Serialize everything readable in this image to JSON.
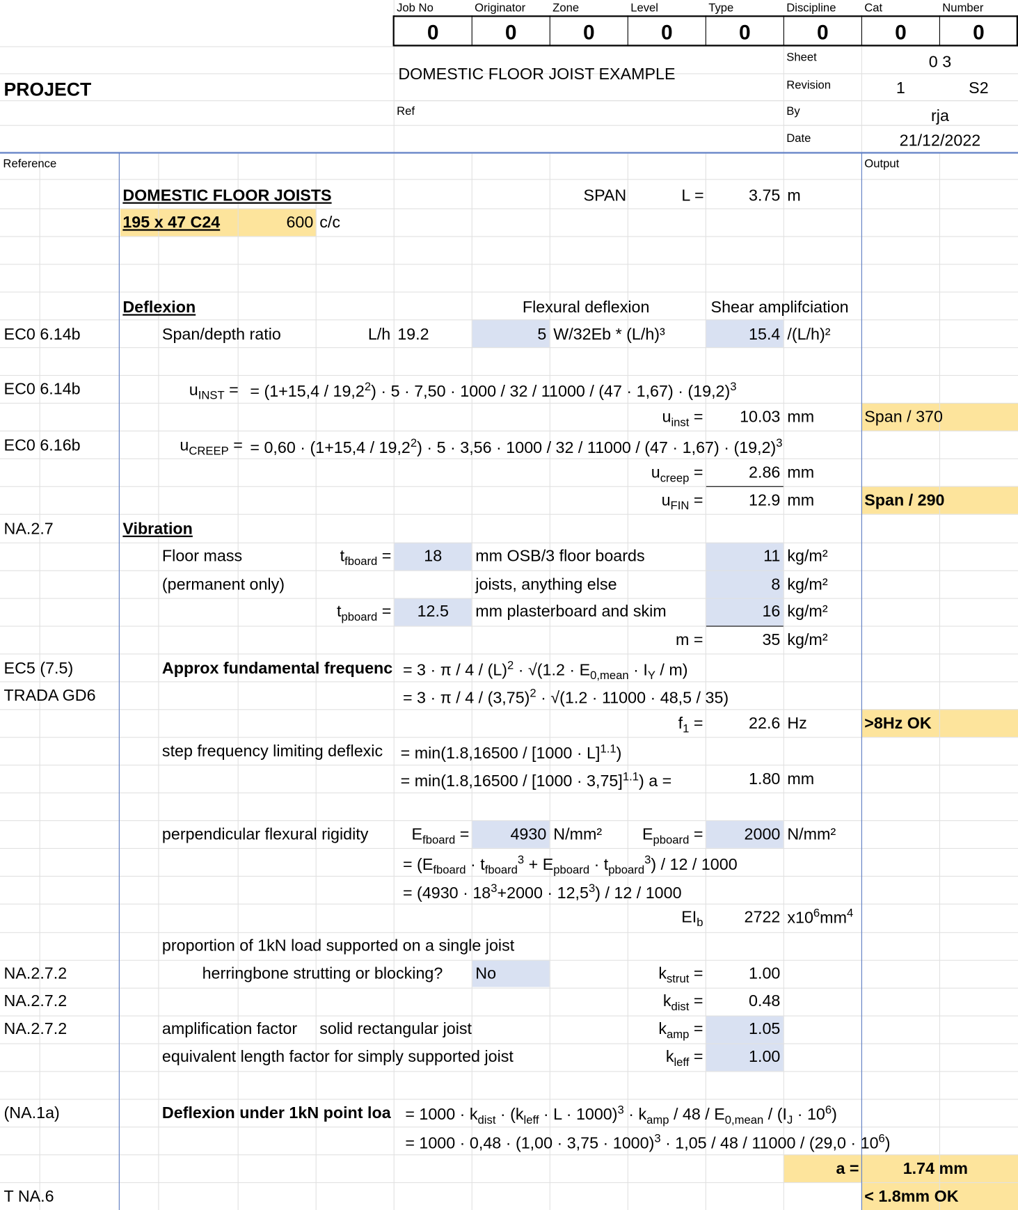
{
  "header": {
    "labels": [
      "Job No",
      "Originator",
      "Zone",
      "Level",
      "Type",
      "Discipline",
      "Cat",
      "Number"
    ],
    "values": [
      "0",
      "0",
      "0",
      "0",
      "0",
      "0",
      "0",
      "0"
    ],
    "project_label": "PROJECT",
    "title": "DOMESTIC FLOOR JOIST EXAMPLE",
    "sheet_label": "Sheet",
    "sheet_value": "0 3",
    "revision_label": "Revision",
    "revision_value": "1",
    "revision_status": "S2",
    "ref_label": "Ref",
    "by_label": "By",
    "by_value": "rja",
    "date_label": "Date",
    "date_value": "21/12/2022",
    "reference_label": "Reference",
    "output_label": "Output"
  },
  "calc": {
    "heading": "DOMESTIC FLOOR JOISTS",
    "section": "195 x 47 C24",
    "spacing": "600",
    "spacing_unit": "c/c",
    "span_label": "SPAN",
    "span_symbol": "L =",
    "span_value": "3.75",
    "span_unit": "m",
    "deflexion_heading": "Deflexion",
    "flexural_deflexion": "Flexural deflexion",
    "shear_amplification": "Shear amplifciation",
    "ref_eco_614b": "EC0 6.14b",
    "ref_eco_616b": "EC0 6.16b",
    "span_depth_label": "Span/depth ratio",
    "lh_label": "L/h",
    "lh_value": "19.2",
    "flex_coeff": "5",
    "flex_formula": "W/32Eb * (L/h)³",
    "shear_coeff": "15.4",
    "shear_formula": "/(L/h)²",
    "uinst_label_main": "u",
    "uinst_label_sub": "INST",
    "uinst_eq_start": "= (1+15,4 / 19,2",
    "uinst_eq_mid": ") · 5 · 7,50 · 1000 / 32 / 11000 / (47 · 1,67) · (19,2)",
    "sup2": "2",
    "sup3": "3",
    "uinst_res_main": "u",
    "uinst_res_sub": "inst",
    "uinst_value": "10.03",
    "mm": "mm",
    "uinst_output": "Span / 370",
    "ucreep_label_main": "u",
    "ucreep_label_sub": "CREEP",
    "ucreep_eq_start": "= 0,60 · (1+15,4 / 19,2",
    "ucreep_eq_mid": ") · 5 · 3,56 · 1000 / 32 / 11000 / (47 · 1,67) · (19,2)",
    "ucreep_res_main": "u",
    "ucreep_res_sub": "creep",
    "ucreep_value": "2.86",
    "ufin_res_main": "u",
    "ufin_res_sub": "FIN",
    "ufin_value": "12.9",
    "ufin_output": "Span / 290",
    "eq": "=",
    "ref_na27": "NA.2.7",
    "vibration_heading": "Vibration",
    "floor_mass_label": "Floor mass",
    "permanent_only": "(permanent only)",
    "t_main": "t",
    "tfboard_sub": "fboard",
    "tfboard_value": "18",
    "osb_label": "mm OSB/3 floor boards",
    "osb_mass": "11",
    "kgm2": "kg/m²",
    "joists_label": "joists, anything else",
    "joists_mass": "8",
    "tpboard_sub": "pboard",
    "tpboard_value": "12.5",
    "plaster_label": "mm plasterboard and skim",
    "plaster_mass": "16",
    "m_label": "m =",
    "m_value": "35",
    "ref_ec5": "EC5 (7.5)",
    "ref_trada": "TRADA GD6",
    "approx_freq_label": "Approx fundamental frequenc",
    "freq_eq1_a": "= 3 · π / 4 / (L)",
    "freq_eq1_b": " · √(1.2 · E",
    "freq_eq1_sub": "0,mean",
    "freq_eq1_c": " · I",
    "freq_eq1_sub2": "Y",
    "freq_eq1_d": " / m)",
    "freq_eq2_a": "= 3 · π / 4 / (3,75)",
    "freq_eq2_b": " · √(1.2 · 11000 · 48,5 / 35)",
    "f1_main": "f",
    "f1_sub": "1",
    "f1_value": "22.6",
    "hz": "Hz",
    "f1_output": ">8Hz OK",
    "step_label": "step frequency limiting deflexic",
    "step_eq1_a": "= min(1.8,16500 / [1000 · L]",
    "step_eq1_sup": "1.1",
    "step_eq1_b": ")",
    "step_eq2_a": "= min(1.8,16500 / [1000 · 3,75]",
    "step_eq2_b": ")   a =",
    "a_value": "1.80",
    "perp_label": "perpendicular flexural rigidity",
    "e_main": "E",
    "efboard_sub": "fboard",
    "efboard_value": "4930",
    "nmm2": "N/mm²",
    "epboard_sub": "pboard",
    "epboard_value": "2000",
    "rig_eq1_a": "= (E",
    "rig_eq1_b": " · t",
    "rig_eq1_c": " + E",
    "rig_eq1_d": ") / 12 / 1000",
    "rig_eq2_a": "= (4930 · 18",
    "rig_eq2_b": "+2000 · 12,5",
    "rig_eq2_c": ") / 12 / 1000",
    "eib_main": "EI",
    "eib_sub": "b",
    "eib_value": "2722",
    "eib_unit_a": "x10",
    "eib_unit_sup": "6",
    "eib_unit_b": "mm",
    "eib_unit_sup2": "4",
    "proportion_label": "proportion of 1kN load supported on a single joist",
    "ref_na272": "NA.2.7.2",
    "herringbone_label": "herringbone strutting or blocking?",
    "herringbone_value": "No",
    "k_main": "k",
    "kstrut_sub": "strut",
    "kstrut_value": "1.00",
    "kdist_sub": "dist",
    "kdist_value": "0.48",
    "amp_label": "amplification factor",
    "solid_label": "solid rectangular joist",
    "kamp_sub": "amp",
    "kamp_value": "1.05",
    "equiv_label": "equivalent length factor for simply supported joist",
    "kleff_sub": "leff",
    "kleff_value": "1.00",
    "ref_na1a": "(NA.1a)",
    "defl_1kn_label": "Deflexion under 1kN point loa",
    "d1_a": "= 1000 · k",
    "d1_b": " · (k",
    "d1_c": " · L · 1000)",
    "d1_d": " · k",
    "d1_e": " / 48 / E",
    "d1_f": " / (I",
    "d1_sub_j": "J",
    "d1_g": " · 10",
    "d1_sup6": "6",
    "d1_h": ")",
    "d2_a": "= 1000 · 0,48 · (1,00 · 3,75 · 1000)",
    "d2_b": " · 1,05 / 48 / 11000 / (29,0 · 10",
    "d2_c": ")",
    "a_final_label": "a =",
    "a_final_value": "1.74 mm",
    "ref_tna6": "T NA.6",
    "final_output": "< 1.8mm OK"
  },
  "colors": {
    "input_blue": "#d9e1f2",
    "output_yellow": "#fde49c",
    "margin_line": "#5f7ec5"
  }
}
